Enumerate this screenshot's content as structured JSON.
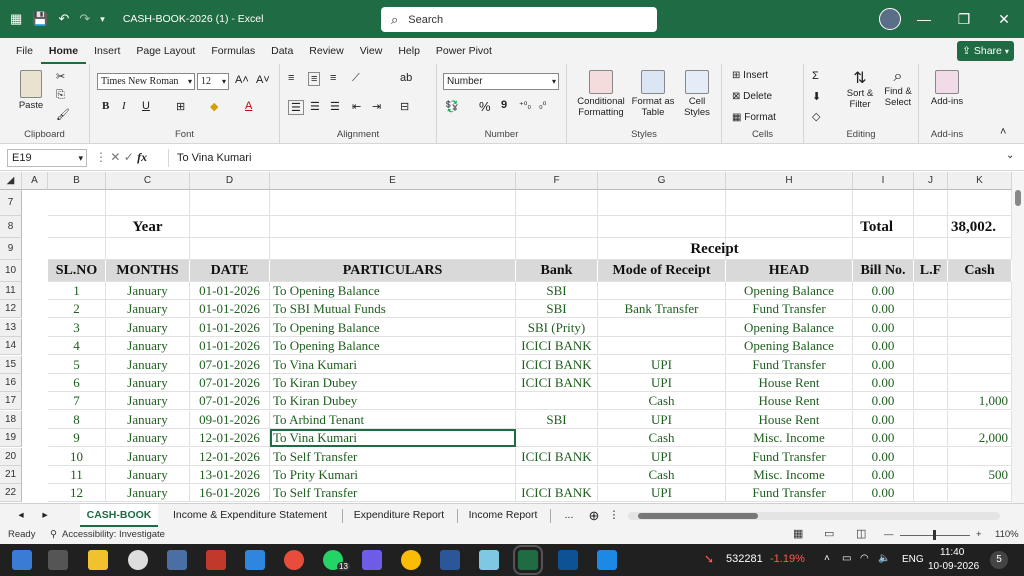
{
  "app": {
    "title": "CASH-BOOK-2026 (1)  -  Excel",
    "search_placeholder": "Search",
    "share_label": "Share"
  },
  "menu": [
    "File",
    "Home",
    "Insert",
    "Page Layout",
    "Formulas",
    "Data",
    "Review",
    "View",
    "Help",
    "Power Pivot"
  ],
  "ribbon": {
    "clipboard": {
      "paste": "Paste",
      "label": "Clipboard"
    },
    "font": {
      "name": "Times New Roman",
      "size": "12",
      "label": "Font",
      "bold": "B",
      "italic": "I",
      "underline": "U"
    },
    "alignment": {
      "label": "Alignment"
    },
    "number": {
      "format": "Number",
      "label": "Number",
      "percent": "%",
      "comma": "9"
    },
    "styles": {
      "conditional": "Conditional",
      "formatting": "Formatting",
      "format_as": "Format as",
      "table": "Table",
      "cell": "Cell",
      "cell_styles": "Styles",
      "label": "Styles"
    },
    "cells": {
      "insert": "Insert",
      "delete": "Delete",
      "format": "Format",
      "label": "Cells"
    },
    "editing": {
      "sort": "Sort &",
      "filter": "Filter",
      "find": "Find &",
      "select": "Select",
      "label": "Editing"
    },
    "addins": {
      "addins": "Add-ins",
      "label": "Add-ins"
    }
  },
  "formula_bar": {
    "name_box": "E19",
    "formula": "To Vina Kumari"
  },
  "columns": [
    "A",
    "B",
    "C",
    "D",
    "E",
    "F",
    "G",
    "H",
    "I",
    "J",
    "K"
  ],
  "sheet": {
    "row8": {
      "year_label": "Year",
      "total_label": "Total",
      "total_value": "38,002."
    },
    "row9": {
      "receipt_label": "Receipt"
    },
    "headers": [
      "SL.NO",
      "MONTHS",
      "DATE",
      "PARTICULARS",
      "Bank",
      "Mode of Receipt",
      "HEAD",
      "Bill No.",
      "L.F",
      "Cash"
    ],
    "rows": [
      {
        "row": "11",
        "sl": "1",
        "month": "January",
        "date": "01-01-2026",
        "particulars": "To Opening Balance",
        "bank": "SBI",
        "mode": "",
        "head": "Opening Balance",
        "bill": "0.00",
        "lf": "",
        "cash": ""
      },
      {
        "row": "12",
        "sl": "2",
        "month": "January",
        "date": "01-01-2026",
        "particulars": "To SBI Mutual Funds",
        "bank": "SBI",
        "mode": "Bank Transfer",
        "head": "Fund Transfer",
        "bill": "0.00",
        "lf": "",
        "cash": ""
      },
      {
        "row": "13",
        "sl": "3",
        "month": "January",
        "date": "01-01-2026",
        "particulars": "To Opening Balance",
        "bank": "SBI (Prity)",
        "mode": "",
        "head": "Opening Balance",
        "bill": "0.00",
        "lf": "",
        "cash": ""
      },
      {
        "row": "14",
        "sl": "4",
        "month": "January",
        "date": "01-01-2026",
        "particulars": "To Opening Balance",
        "bank": "ICICI BANK",
        "mode": "",
        "head": "Opening Balance",
        "bill": "0.00",
        "lf": "",
        "cash": ""
      },
      {
        "row": "15",
        "sl": "5",
        "month": "January",
        "date": "07-01-2026",
        "particulars": "To Vina Kumari",
        "bank": "ICICI BANK",
        "mode": "UPI",
        "head": "Fund Transfer",
        "bill": "0.00",
        "lf": "",
        "cash": ""
      },
      {
        "row": "16",
        "sl": "6",
        "month": "January",
        "date": "07-01-2026",
        "particulars": "To Kiran Dubey",
        "bank": "ICICI BANK",
        "mode": "UPI",
        "head": "House Rent",
        "bill": "0.00",
        "lf": "",
        "cash": ""
      },
      {
        "row": "17",
        "sl": "7",
        "month": "January",
        "date": "07-01-2026",
        "particulars": "To Kiran Dubey",
        "bank": "",
        "mode": "Cash",
        "head": "House Rent",
        "bill": "0.00",
        "lf": "",
        "cash": "1,000"
      },
      {
        "row": "18",
        "sl": "8",
        "month": "January",
        "date": "09-01-2026",
        "particulars": "To Arbind Tenant",
        "bank": "SBI",
        "mode": "UPI",
        "head": "House Rent",
        "bill": "0.00",
        "lf": "",
        "cash": ""
      },
      {
        "row": "19",
        "sl": "9",
        "month": "January",
        "date": "12-01-2026",
        "particulars": "To Vina Kumari",
        "bank": "",
        "mode": "Cash",
        "head": "Misc. Income",
        "bill": "0.00",
        "lf": "",
        "cash": "2,000"
      },
      {
        "row": "20",
        "sl": "10",
        "month": "January",
        "date": "12-01-2026",
        "particulars": "To Self Transfer",
        "bank": "ICICI BANK",
        "mode": "UPI",
        "head": "Fund Transfer",
        "bill": "0.00",
        "lf": "",
        "cash": ""
      },
      {
        "row": "21",
        "sl": "11",
        "month": "January",
        "date": "13-01-2026",
        "particulars": "To Prity Kumari",
        "bank": "",
        "mode": "Cash",
        "head": "Misc. Income",
        "bill": "0.00",
        "lf": "",
        "cash": "500"
      },
      {
        "row": "22",
        "sl": "12",
        "month": "January",
        "date": "16-01-2026",
        "particulars": "To Self Transfer",
        "bank": "ICICI BANK",
        "mode": "UPI",
        "head": "Fund Transfer",
        "bill": "0.00",
        "lf": "",
        "cash": ""
      }
    ],
    "row_numbers_top": [
      "7",
      "8",
      "9",
      "10"
    ]
  },
  "sheet_tabs": [
    "CASH-BOOK",
    "Income & Expenditure Statement",
    "Expenditure Report",
    "Income Report",
    "..."
  ],
  "status": {
    "ready": "Ready",
    "accessibility": "Accessibility: Investigate",
    "zoom": "110%"
  },
  "taskbar": {
    "stock_value": "532281",
    "stock_change": "-1.19%",
    "language": "ENG",
    "time": "11:40",
    "date": "10-09-2026",
    "whatsapp_badge": "13",
    "notif_count": "5"
  },
  "colors": {
    "excel_green": "#1f6b43",
    "cell_text": "#1e5e1e",
    "stock_red": "#ff5a4e"
  }
}
